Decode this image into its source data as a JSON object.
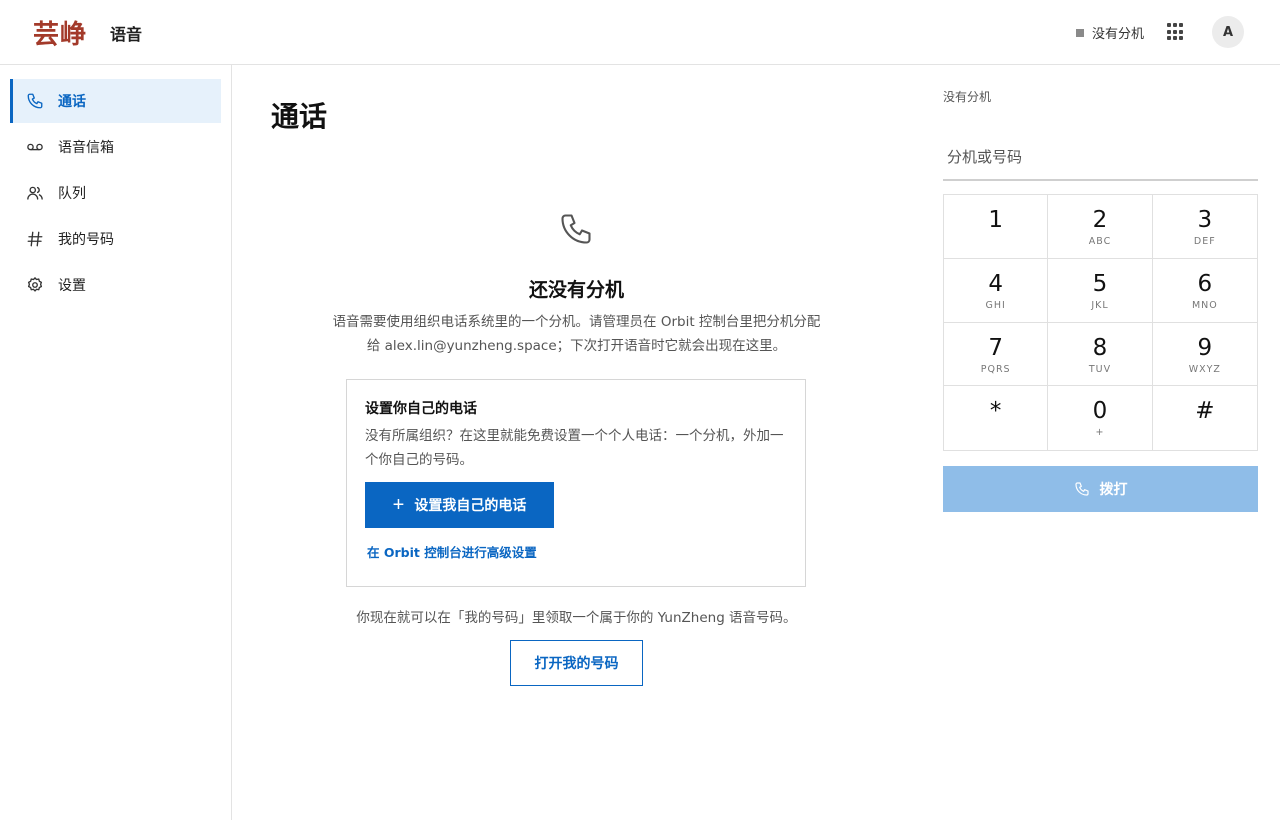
{
  "header": {
    "logo": "芸峥",
    "app_title": "语音",
    "extension_status": "没有分机",
    "avatar_initial": "A"
  },
  "sidebar": {
    "items": [
      {
        "label": "通话",
        "icon": "phone-icon",
        "active": true
      },
      {
        "label": "语音信箱",
        "icon": "voicemail-icon",
        "active": false
      },
      {
        "label": "队列",
        "icon": "people-icon",
        "active": false
      },
      {
        "label": "我的号码",
        "icon": "hash-icon",
        "active": false
      },
      {
        "label": "设置",
        "icon": "gear-icon",
        "active": false
      }
    ]
  },
  "main": {
    "title": "通话",
    "empty_title": "还没有分机",
    "empty_desc": "语音需要使用组织电话系统里的一个分机。请管理员在 Orbit 控制台里把分机分配给 alex.lin@yunzheng.space；下次打开语音时它就会出现在这里。",
    "card": {
      "title": "设置你自己的电话",
      "desc": "没有所属组织？在这里就能免费设置一个个人电话：一个分机，外加一个你自己的号码。",
      "button_label": "设置我自己的电话",
      "link_label": "在 Orbit 控制台进行高级设置"
    },
    "hint": "你现在就可以在「我的号码」里领取一个属于你的 YunZheng 语音号码。",
    "open_numbers_label": "打开我的号码"
  },
  "dialer": {
    "label": "没有分机",
    "input_placeholder": "分机或号码",
    "keys": [
      {
        "digit": "1",
        "letters": ""
      },
      {
        "digit": "2",
        "letters": "ABC"
      },
      {
        "digit": "3",
        "letters": "DEF"
      },
      {
        "digit": "4",
        "letters": "GHI"
      },
      {
        "digit": "5",
        "letters": "JKL"
      },
      {
        "digit": "6",
        "letters": "MNO"
      },
      {
        "digit": "7",
        "letters": "PQRS"
      },
      {
        "digit": "8",
        "letters": "TUV"
      },
      {
        "digit": "9",
        "letters": "WXYZ"
      },
      {
        "digit": "*",
        "letters": ""
      },
      {
        "digit": "0",
        "letters": "+"
      },
      {
        "digit": "#",
        "letters": ""
      }
    ],
    "call_label": "拨打"
  },
  "colors": {
    "accent": "#0a66c2",
    "accent_light": "#e6f1fb",
    "call_disabled": "#8fbde8",
    "logo": "#a33a2a"
  }
}
